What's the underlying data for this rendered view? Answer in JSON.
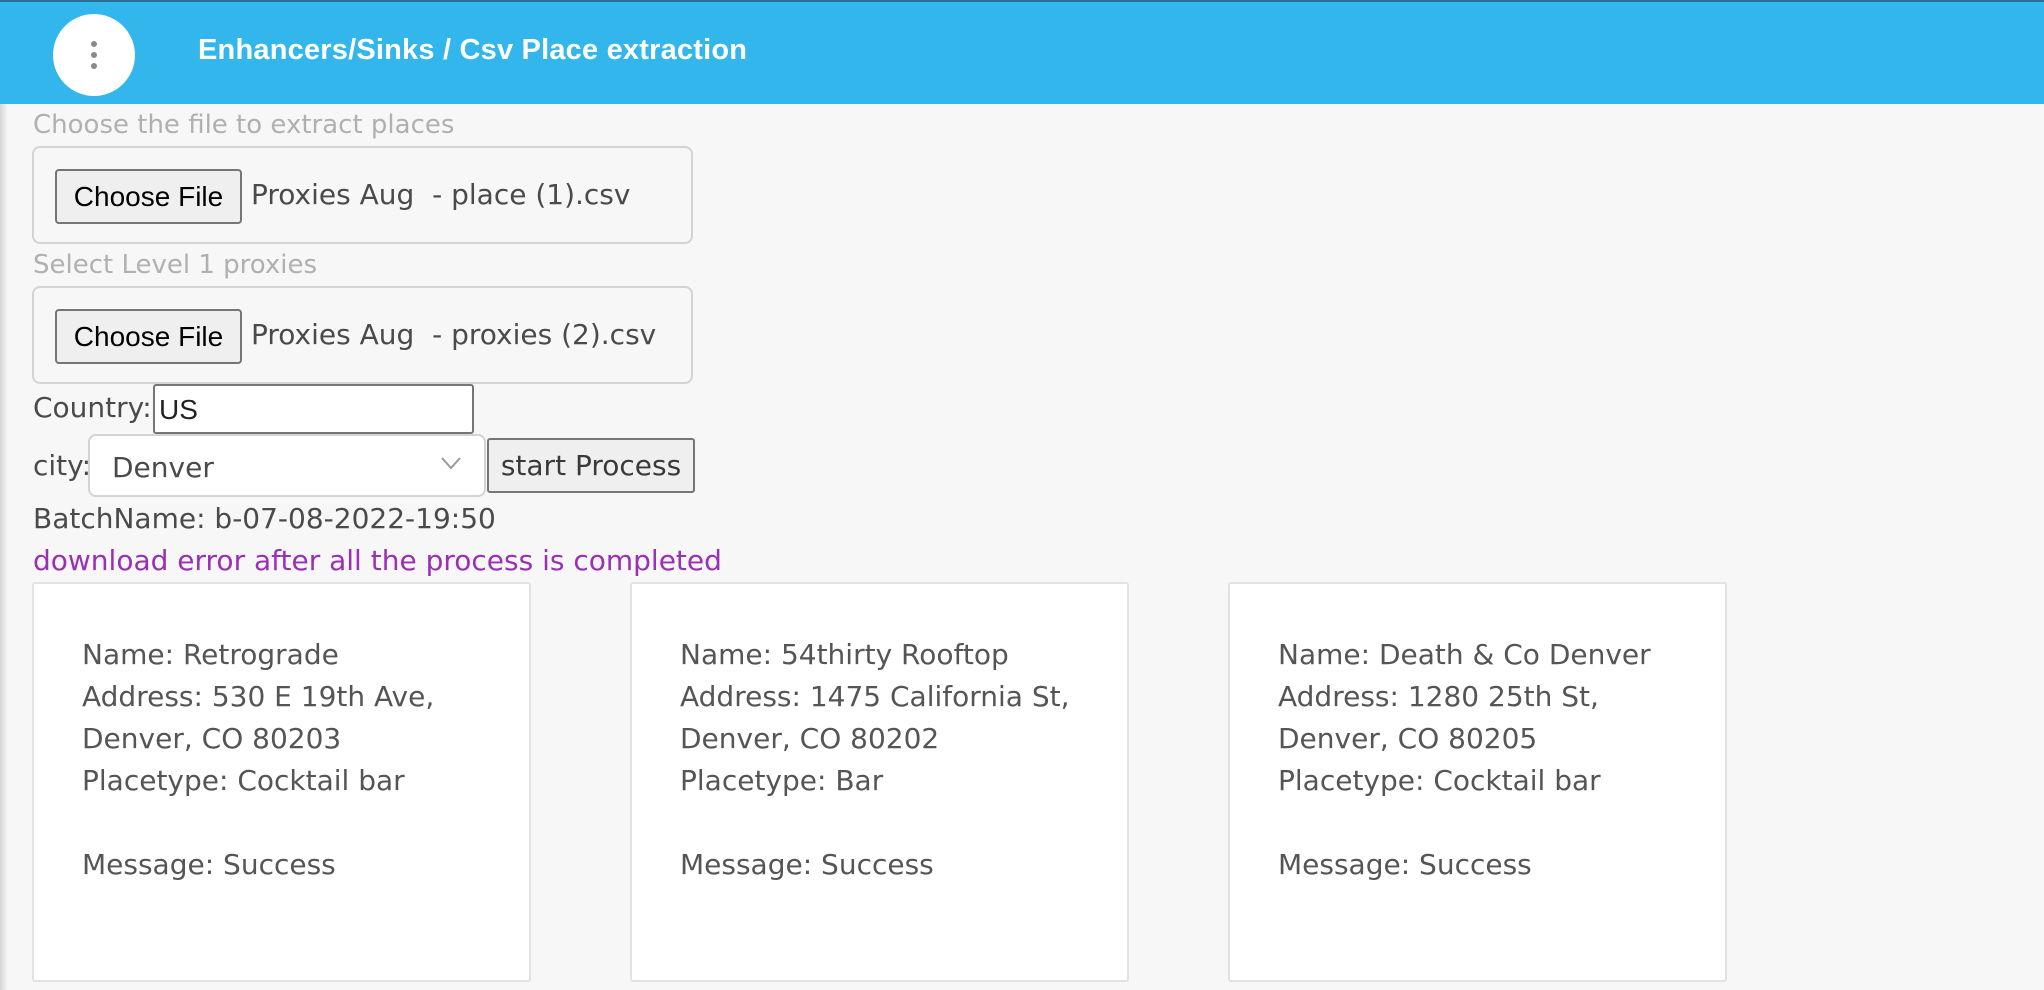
{
  "header": {
    "title": "Enhancers/Sinks / Csv Place extraction",
    "menu_icon": "more-vertical-icon",
    "background": "#33b6ec"
  },
  "form": {
    "file_label": "Choose the file to extract places",
    "file_button": "Choose File",
    "file_name": "Proxies Aug  - place (1).csv",
    "proxies_label": "Select Level 1 proxies",
    "proxies_button": "Choose File",
    "proxies_file_name": "Proxies Aug  - proxies (2).csv",
    "country_label": "Country:",
    "country_value": "US",
    "city_label": "city:",
    "city_value": "Denver",
    "city_icon": "chevron-down-icon",
    "start_button": "start Process",
    "batch_name": "BatchName: b-07-08-2022-19:50",
    "download_link": "download error after all the process is completed",
    "link_color": "#9b2fb5"
  },
  "results": [
    {
      "name": "Name: Retrograde",
      "address_1": "Address: 530 E 19th Ave,",
      "address_2": "Denver, CO 80203",
      "placetype": "Placetype: Cocktail bar",
      "message": "Message: Success"
    },
    {
      "name": "Name: 54thirty Rooftop",
      "address_1": "Address: 1475 California St,",
      "address_2": "Denver, CO 80202",
      "placetype": "Placetype: Bar",
      "message": "Message: Success"
    },
    {
      "name": "Name: Death & Co Denver",
      "address_1": "Address: 1280 25th St,",
      "address_2": "Denver, CO 80205",
      "placetype": "Placetype: Cocktail bar",
      "message": "Message: Success"
    }
  ]
}
